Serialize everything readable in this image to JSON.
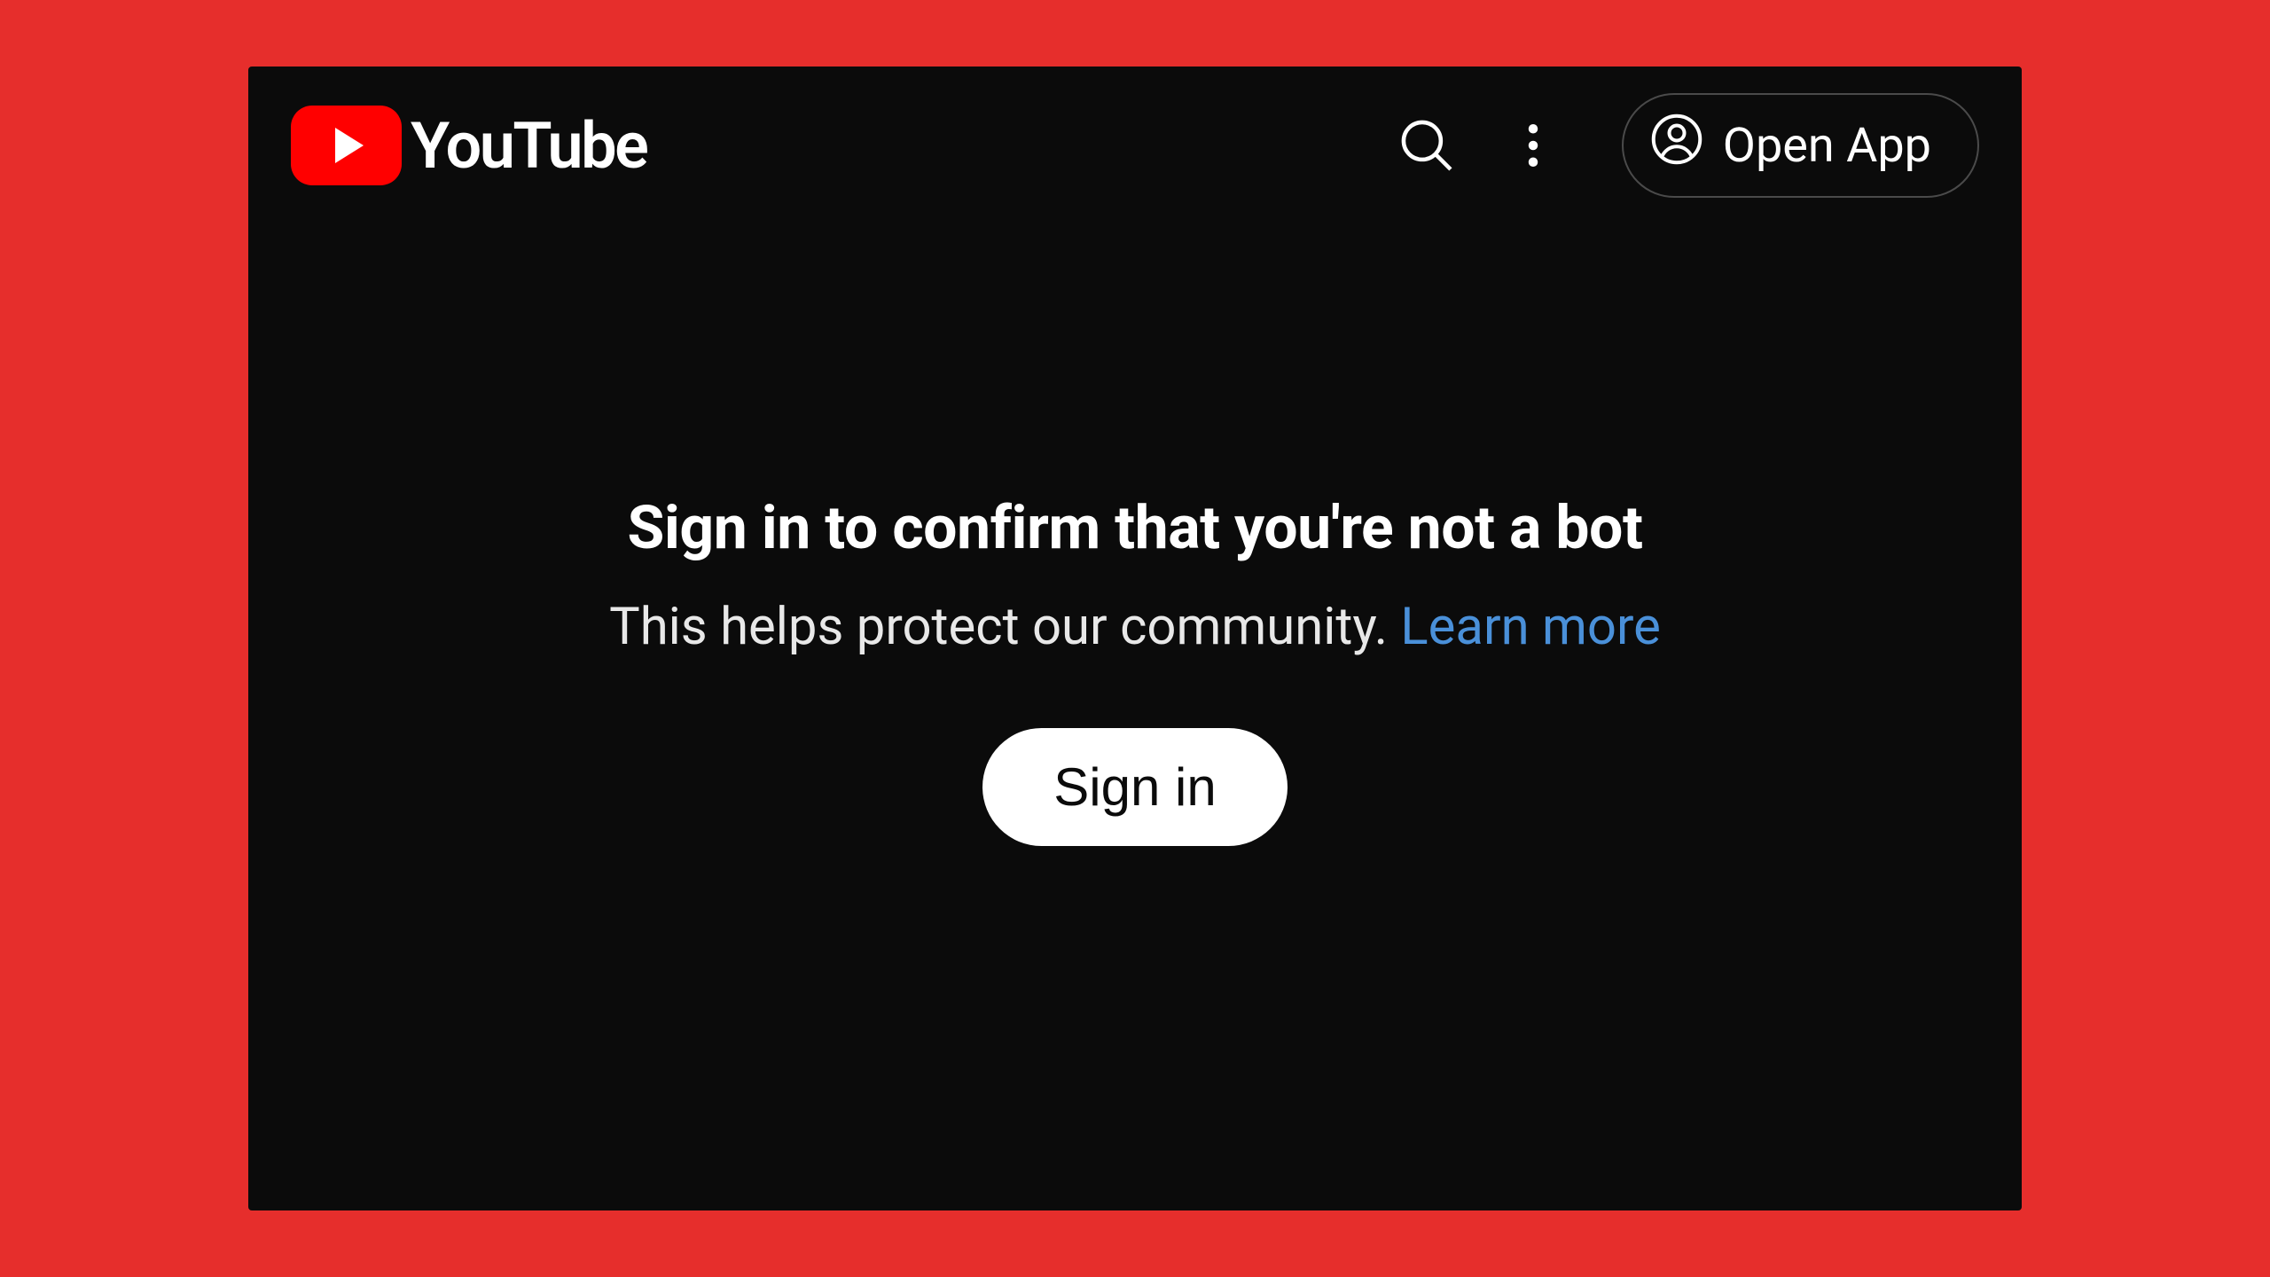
{
  "header": {
    "brand_name": "YouTube",
    "open_app_label": "Open App"
  },
  "content": {
    "heading": "Sign in to confirm that you're not a bot",
    "subtext": "This helps protect our community. ",
    "learn_more_label": "Learn more",
    "signin_label": "Sign in"
  },
  "colors": {
    "background": "#e62e2c",
    "panel": "#0b0b0b",
    "brand_red": "#ff0000",
    "link_blue": "#4a90d9"
  }
}
